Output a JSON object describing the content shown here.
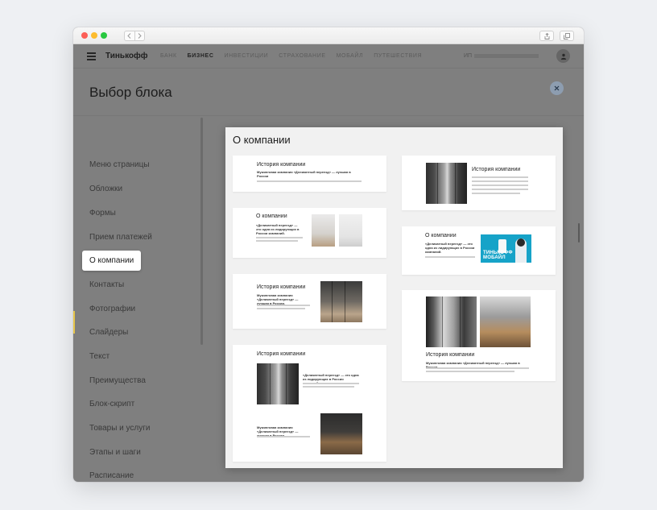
{
  "window": {
    "title": ""
  },
  "header": {
    "brand": "Тинькофф",
    "nav": [
      "БАНК",
      "БИЗНЕС",
      "ИНВЕСТИЦИИ",
      "СТРАХОВАНИЕ",
      "МОБАЙЛ",
      "ПУТЕШЕСТВИЯ"
    ],
    "active_nav": "БИЗНЕС",
    "account_prefix": "ИП"
  },
  "page": {
    "title": "Выбор блока"
  },
  "sidebar": {
    "items": [
      {
        "label": "Меню страницы"
      },
      {
        "label": "Обложки"
      },
      {
        "label": "Формы"
      },
      {
        "label": "Прием платежей"
      },
      {
        "label": "О компании",
        "active": true
      },
      {
        "label": "Контакты"
      },
      {
        "label": "Фотографии"
      },
      {
        "label": "Слайдеры"
      },
      {
        "label": "Текст"
      },
      {
        "label": "Преимущества"
      },
      {
        "label": "Блок-скрипт"
      },
      {
        "label": "Товары и услуги"
      },
      {
        "label": "Этапы и шаги"
      },
      {
        "label": "Расписание"
      }
    ]
  },
  "panel": {
    "title": "О компании",
    "cards": {
      "c1": {
        "heading": "История компании",
        "sub": "Мужинговая компания «Деликатный переезд» — лучшая в России"
      },
      "c2": {
        "heading": "О компании",
        "sub": "«Деликатный переезд» — это одна из лидирующих в России компаний."
      },
      "c3": {
        "heading": "История компании",
        "sub": "Мужинговая компания «Деликатный переезд» — лучшая в России."
      },
      "c4": {
        "heading": "История компании",
        "sub": "«Деликатный переезд» — это одна из лидирующих в России компаний.",
        "sub2": "Мужинговая компания «Деликатный переезд» — лучшая в России"
      },
      "c5": {
        "heading": "История компании"
      },
      "c6": {
        "heading": "О компании",
        "sub": "«Деликатный переезд» — это одна из лидирующих в России компаний.",
        "brand": "ТИНЬКОФФ МОБАЙЛ"
      },
      "c7": {
        "heading": "История компании",
        "sub": "Мужинговая компания «Деликатный переезд» — лучшая в России"
      }
    }
  },
  "colors": {
    "accent": "#e7c64a",
    "overlay": "#7f7f7f",
    "panel": "#f1f1f1",
    "brand_blue": "#16a3c8"
  }
}
